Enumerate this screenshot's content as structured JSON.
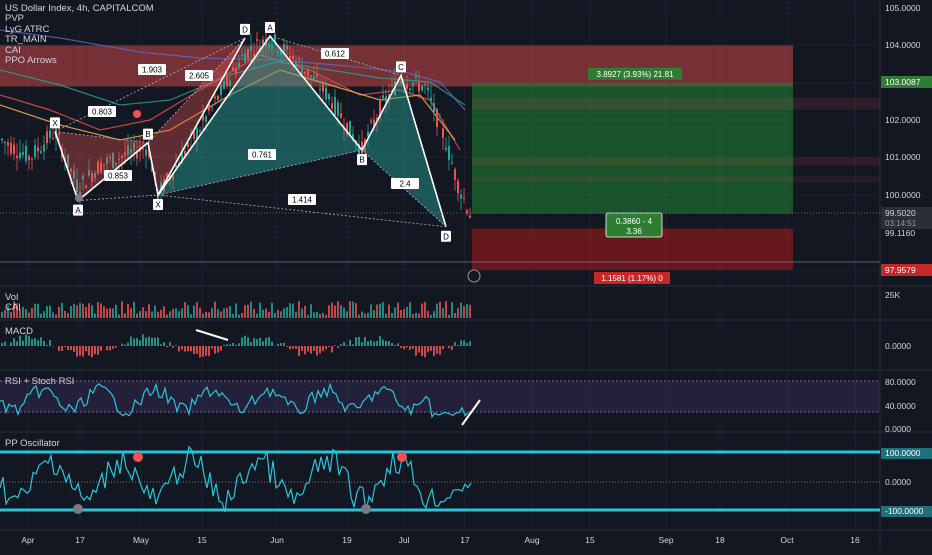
{
  "header": {
    "symbol_title": "US Dollar Index, 4h, CAPITALCOM",
    "indicators": [
      "PVP",
      "LyG ATRC",
      "TR_MAIN",
      "CAI",
      "PPO Arrows"
    ]
  },
  "price_axis": {
    "ticks": [
      "105.0000",
      "104.0000",
      "102.0000",
      "101.0000",
      "100.0000",
      "99.1160"
    ],
    "current_price": "99.5020",
    "countdown": "03:14:51",
    "target_label": "103.0087",
    "stop_label": "97.9579"
  },
  "time_axis": [
    "Apr",
    "17",
    "May",
    "15",
    "Jun",
    "19",
    "Jul",
    "17",
    "Aug",
    "15",
    "Sep",
    "18",
    "Oct",
    "16"
  ],
  "harmonic_pattern": {
    "points": [
      {
        "label": "X",
        "price": 101.7
      },
      {
        "label": "A",
        "price": 99.85
      },
      {
        "label": "B",
        "price": 101.4
      },
      {
        "label": "X",
        "price": 100.0
      },
      {
        "label": "D",
        "price": 104.2
      },
      {
        "label": "A",
        "price": 104.25
      },
      {
        "label": "B",
        "price": 101.2
      },
      {
        "label": "C",
        "price": 103.2
      },
      {
        "label": "D",
        "price": 99.15
      }
    ],
    "ratios": [
      "1.903",
      "0.803",
      "2.605",
      "0.853",
      "0.612",
      "0.761",
      "1.414",
      "2.4"
    ]
  },
  "position": {
    "profit_label": "3.8927 (3.93%) 21.81",
    "ratio_line1": "0.3860 - 4",
    "ratio_line2": "3.36",
    "loss_label": "1.1581 (1.17%) 0"
  },
  "panels": {
    "vol": {
      "title": "Vol",
      "sub": "CAI",
      "axis": "25K"
    },
    "macd": {
      "title": "MACD",
      "axis": "0.0000"
    },
    "rsi": {
      "title": "RSI + Stoch RSI",
      "axis": [
        "80.0000",
        "40.0000",
        "0.0000"
      ]
    },
    "pp": {
      "title": "PP Oscillator",
      "axis": [
        "100.0000",
        "0.0000",
        "-100.0000"
      ]
    }
  },
  "colors": {
    "background": "#131722",
    "bull": "#26a69a",
    "bear": "#ef5350",
    "profit_zone": "#1b5e20",
    "loss_zone": "#8e1a1a",
    "pattern_label_bg": "#ffffff",
    "oscillator": "#26c6da"
  }
}
